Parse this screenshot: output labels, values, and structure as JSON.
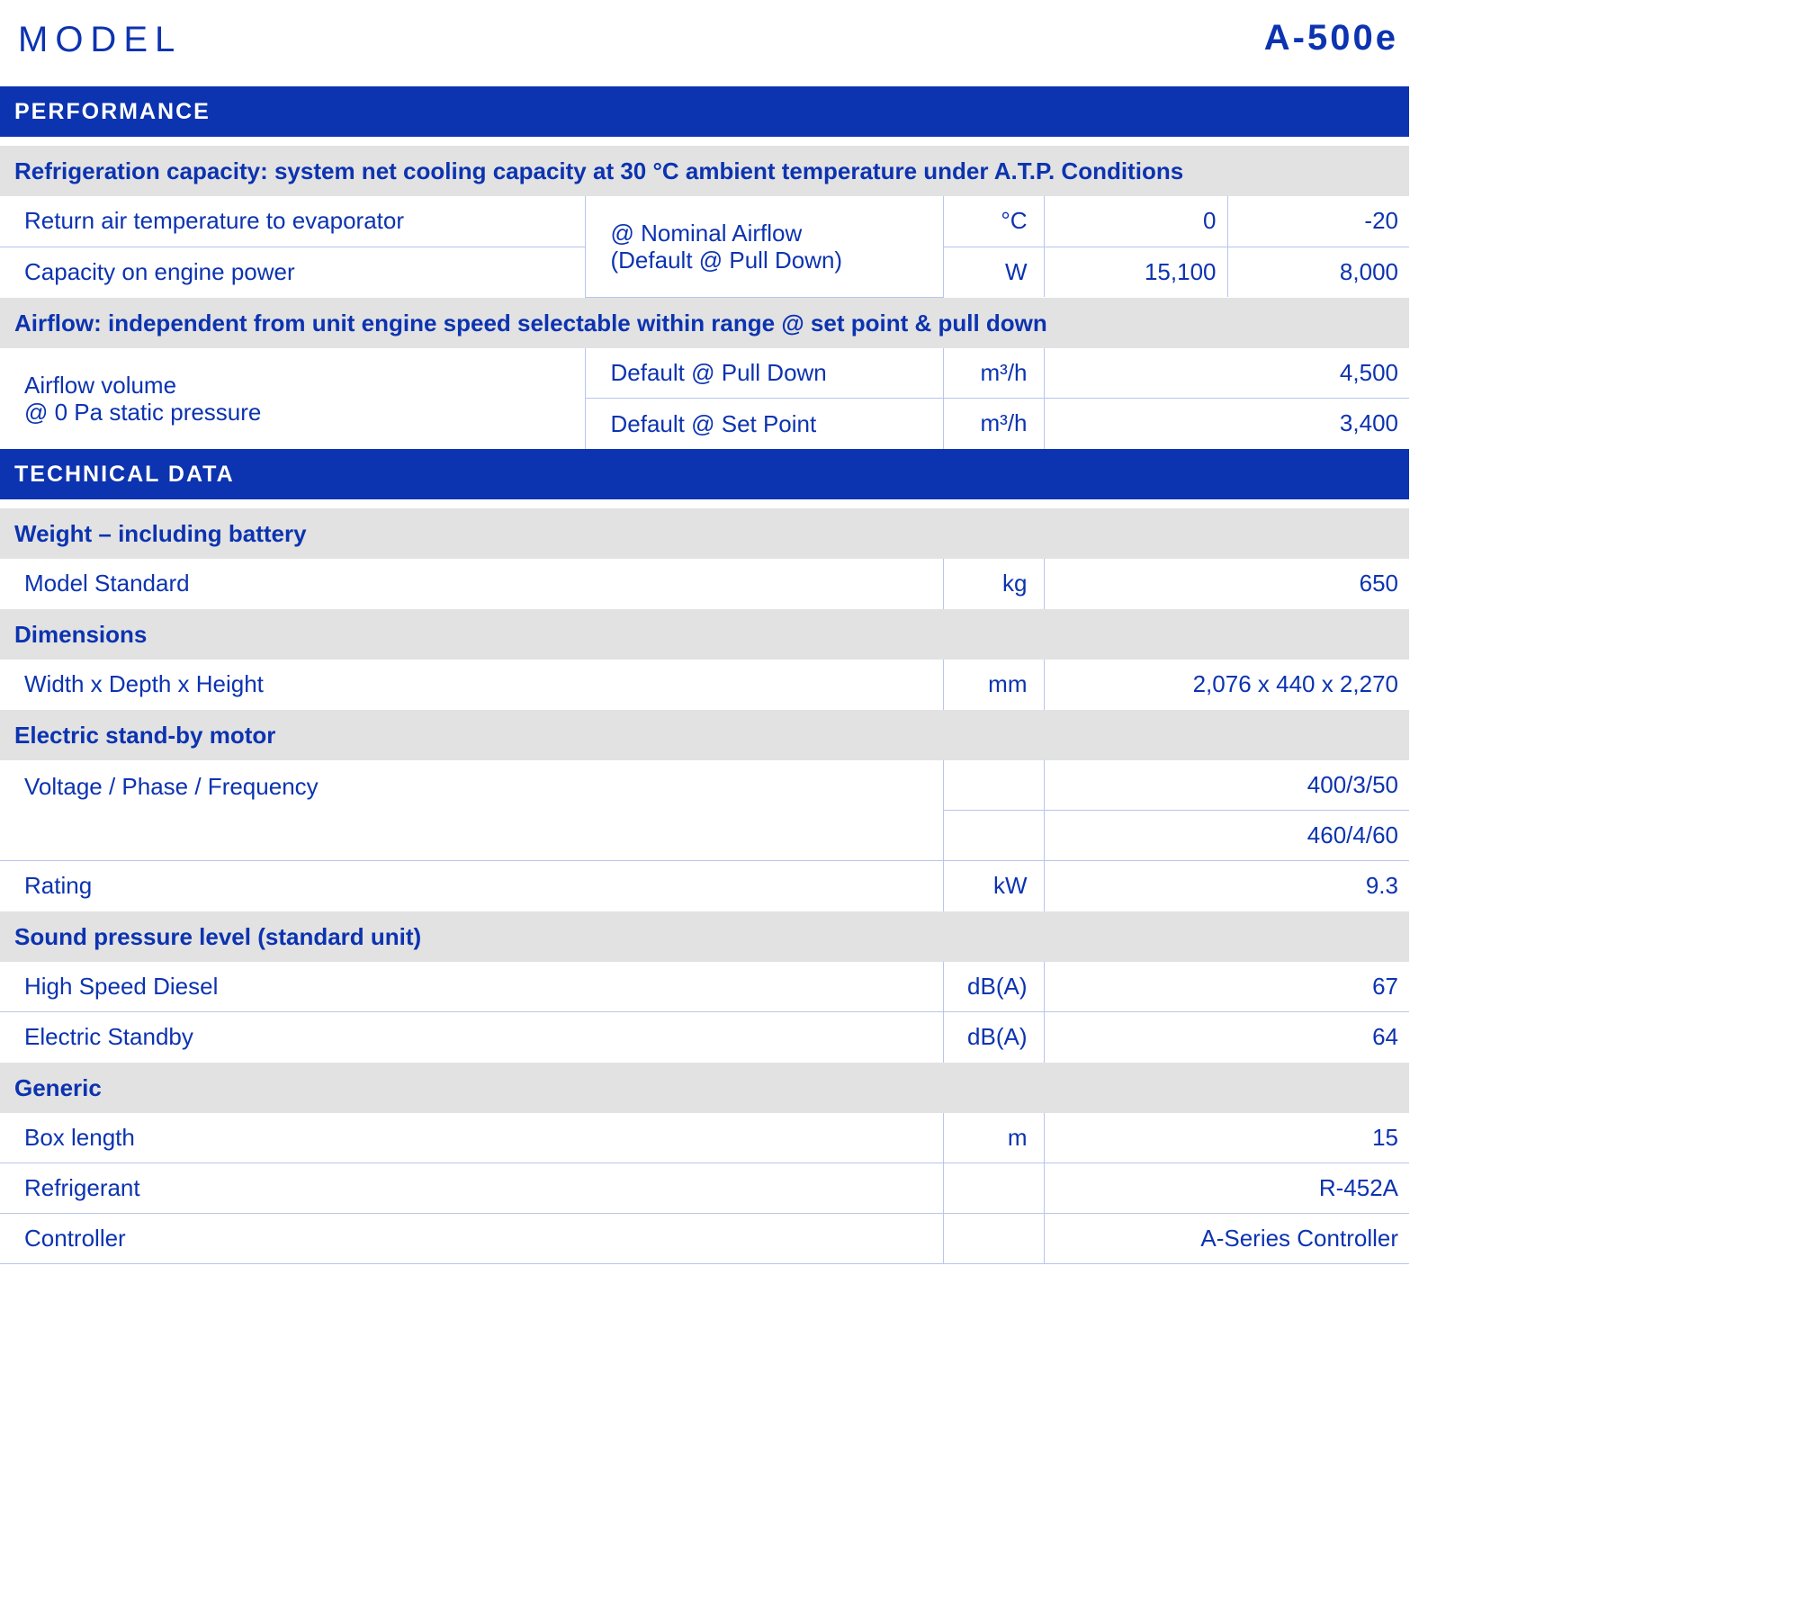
{
  "header": {
    "title": "MODEL",
    "model": "A-500e"
  },
  "colors": {
    "brand_blue": "#0c33b0",
    "group_gray": "#e2e2e2",
    "border": "#b8c6ee"
  },
  "performance": {
    "section_title": "PERFORMANCE",
    "refrigeration": {
      "group_title": "Refrigeration capacity: system net cooling capacity at 30 °C ambient temperature under A.T.P. Conditions",
      "condition_line1": "@ Nominal Airflow",
      "condition_line2": "(Default @ Pull Down)",
      "rows": [
        {
          "label": "Return air temperature to evaporator",
          "unit": "°C",
          "value1": "0",
          "value2": "-20"
        },
        {
          "label": "Capacity on engine power",
          "unit": "W",
          "value1": "15,100",
          "value2": "8,000"
        }
      ]
    },
    "airflow": {
      "group_title": "Airflow: independent from unit engine speed selectable within range @ set point & pull down",
      "label_line1": "Airflow volume",
      "label_line2": "@ 0 Pa static pressure",
      "rows": [
        {
          "condition": "Default @ Pull Down",
          "unit": "m³/h",
          "value": "4,500"
        },
        {
          "condition": "Default @ Set Point",
          "unit": "m³/h",
          "value": "3,400"
        }
      ]
    }
  },
  "technical": {
    "section_title": "TECHNICAL DATA",
    "weight": {
      "group_title": "Weight – including battery",
      "rows": [
        {
          "label": "Model Standard",
          "unit": "kg",
          "value": "650"
        }
      ]
    },
    "dimensions": {
      "group_title": "Dimensions",
      "rows": [
        {
          "label": "Width x Depth x Height",
          "unit": "mm",
          "value": "2,076 x 440 x 2,270"
        }
      ]
    },
    "motor": {
      "group_title": "Electric stand-by motor",
      "vpf_label": "Voltage / Phase / Frequency",
      "vpf_values": [
        "400/3/50",
        "460/4/60"
      ],
      "rating": {
        "label": "Rating",
        "unit": "kW",
        "value": "9.3"
      }
    },
    "sound": {
      "group_title": "Sound pressure level (standard unit)",
      "rows": [
        {
          "label": "High Speed Diesel",
          "unit": "dB(A)",
          "value": "67"
        },
        {
          "label": "Electric Standby",
          "unit": "dB(A)",
          "value": "64"
        }
      ]
    },
    "generic": {
      "group_title": "Generic",
      "rows": [
        {
          "label": "Box length",
          "unit": "m",
          "value": "15"
        },
        {
          "label": "Refrigerant",
          "unit": "",
          "value": "R-452A"
        },
        {
          "label": "Controller",
          "unit": "",
          "value": "A-Series Controller"
        }
      ]
    }
  }
}
